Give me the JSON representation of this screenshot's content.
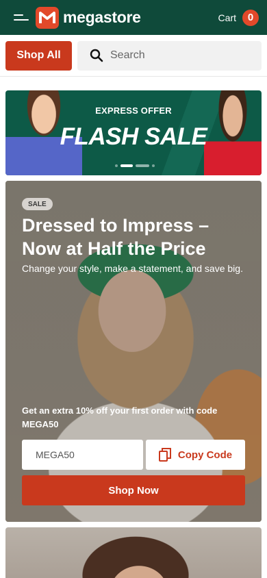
{
  "header": {
    "logo_text": "megastore",
    "cart_label": "Cart",
    "cart_count": "0",
    "brand_color": "#0f4a3a",
    "accent_color": "#e2492a"
  },
  "search": {
    "shop_all_label": "Shop All",
    "placeholder": "Search"
  },
  "banner": {
    "kicker": "EXPRESS OFFER",
    "title": "FLASH SALE",
    "slides": 4,
    "active_slide": 2
  },
  "promo": {
    "badge": "SALE",
    "title": "Dressed to Impress – Now at Half the Price",
    "subtitle": "Change your style, make a statement, and save big.",
    "offer_text": "Get an extra 10% off your first order with code MEGA50",
    "code_value": "MEGA50",
    "copy_label": "Copy Code",
    "cta_label": "Shop Now",
    "button_color": "#c9391d"
  }
}
